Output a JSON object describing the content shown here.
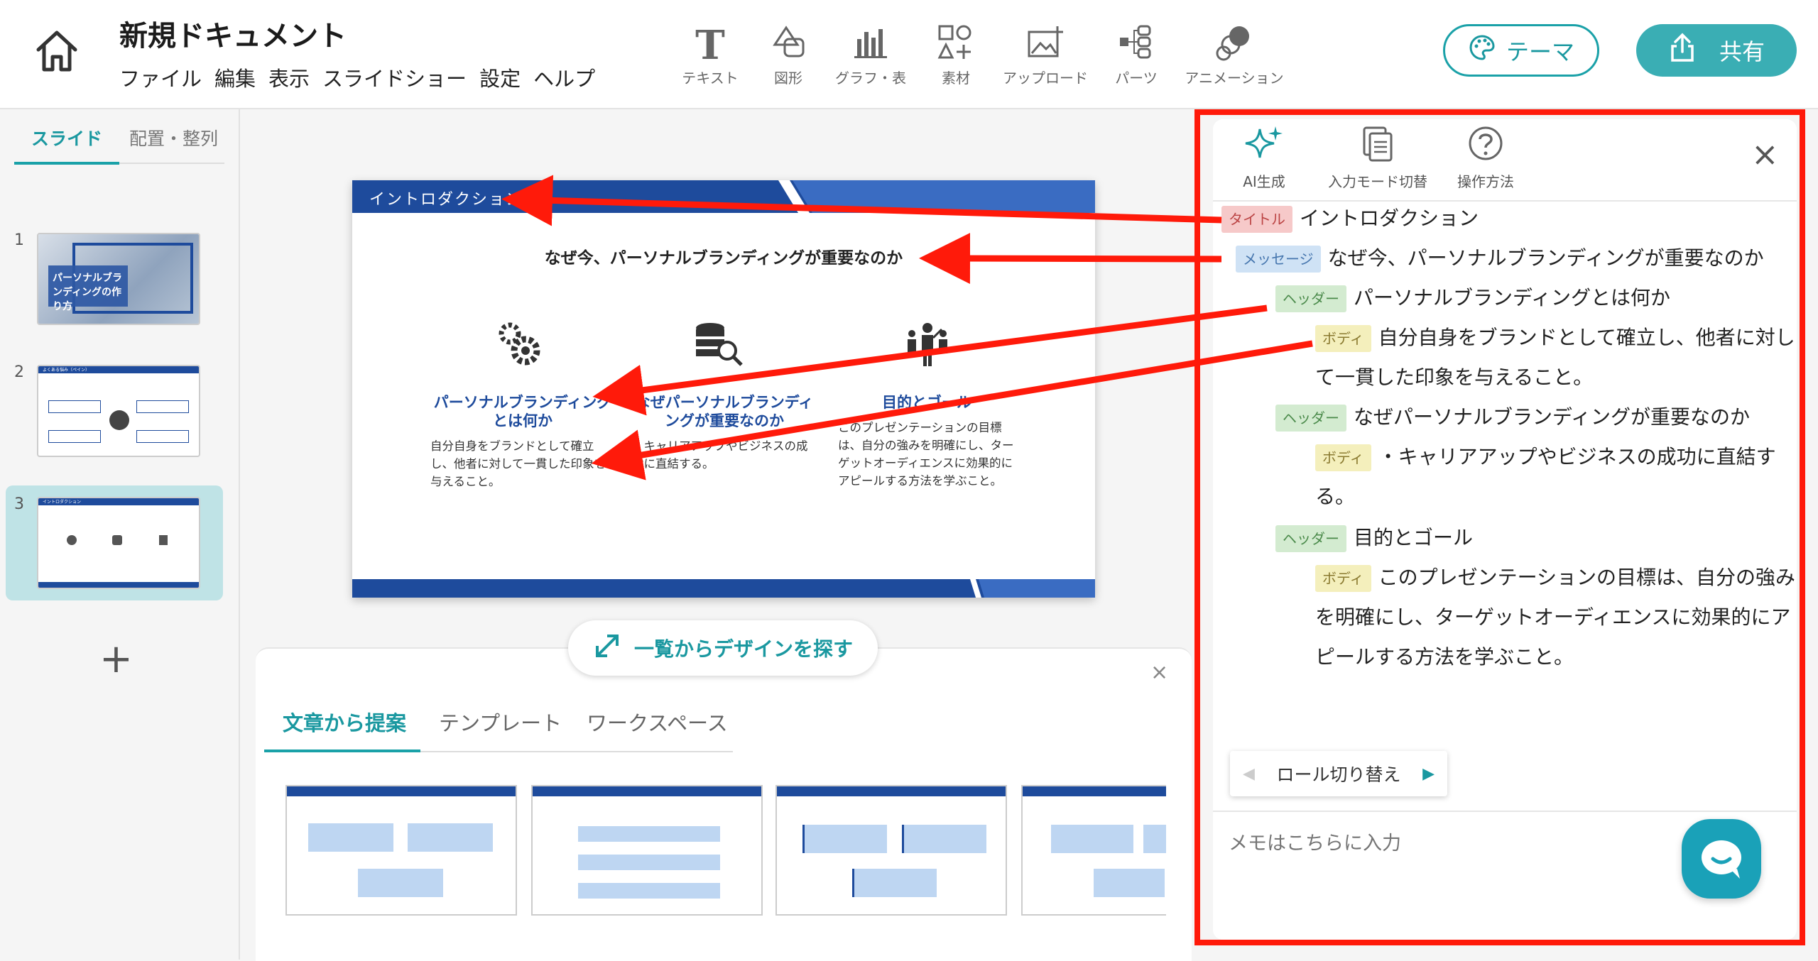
{
  "header": {
    "doc_title": "新規ドキュメント",
    "menu": [
      "ファイル",
      "編集",
      "表示",
      "スライドショー",
      "設定",
      "ヘルプ"
    ],
    "tools": [
      {
        "label": "テキスト",
        "icon": "text-icon"
      },
      {
        "label": "図形",
        "icon": "shape-icon"
      },
      {
        "label": "グラフ・表",
        "icon": "chart-icon"
      },
      {
        "label": "素材",
        "icon": "assets-icon"
      },
      {
        "label": "アップロード",
        "icon": "upload-image-icon"
      },
      {
        "label": "パーツ",
        "icon": "parts-icon"
      },
      {
        "label": "アニメーション",
        "icon": "animation-icon"
      }
    ],
    "theme_label": "テーマ",
    "share_label": "共有"
  },
  "left_panel": {
    "tabs": [
      "スライド",
      "配置・整列"
    ],
    "thumbnails": [
      {
        "num": "1",
        "text": "パーソナルブランディングの作り方"
      },
      {
        "num": "2",
        "text": "よくある悩み（ペイン）"
      },
      {
        "num": "3",
        "text": "イントロダクション"
      }
    ],
    "add": "+"
  },
  "slide": {
    "title": "イントロダクション",
    "message": "なぜ今、パーソナルブランディングが重要なのか",
    "columns": [
      {
        "header": "パーソナルブランディングとは何か",
        "body": "自分自身をブランドとして確立し、他者に対して一貫した印象を与えること。"
      },
      {
        "header": "なぜパーソナルブランディングが重要なのか",
        "body": "・キャリアアップやビジネスの成功に直結する。"
      },
      {
        "header": "目的とゴール",
        "body": "このプレゼンテーションの目標は、自分の強みを明確にし、ターゲットオーディエンスに効果的にアピールする方法を学ぶこと。"
      }
    ]
  },
  "design_panel": {
    "find_button": "一覧からデザインを探す",
    "tabs": [
      "文章から提案",
      "テンプレート",
      "ワークスペース"
    ],
    "close": "×"
  },
  "outline_panel": {
    "tools": [
      "AI生成",
      "入力モード切替",
      "操作方法"
    ],
    "close": "×",
    "rows": [
      {
        "tag": "タイトル",
        "text": "イントロダクション"
      },
      {
        "tag": "メッセージ",
        "text": "なぜ今、パーソナルブランディングが重要なのか"
      },
      {
        "tag": "ヘッダー",
        "text": "パーソナルブランディングとは何か"
      },
      {
        "tag": "ボディ",
        "text": "自分自身をブランドとして確立し、他者に対して一貫した印象を与えること。"
      },
      {
        "tag": "ヘッダー",
        "text": "なぜパーソナルブランディングが重要なのか"
      },
      {
        "tag": "ボディ",
        "text": "・キャリアアップやビジネスの成功に直結する。"
      },
      {
        "tag": "ヘッダー",
        "text": "目的とゴール"
      },
      {
        "tag": "ボディ",
        "text": "このプレゼンテーションの目標は、自分の強みを明確にし、ターゲットオーディエンスに効果的にアピールする方法を学ぶこと。"
      }
    ],
    "role_switch": "ロール切り替え",
    "memo_placeholder": "メモはこちらに入力"
  },
  "colors": {
    "accent": "#1aa1a8",
    "slide_blue": "#1e4b9c",
    "highlight_red": "#ff1a0a"
  }
}
